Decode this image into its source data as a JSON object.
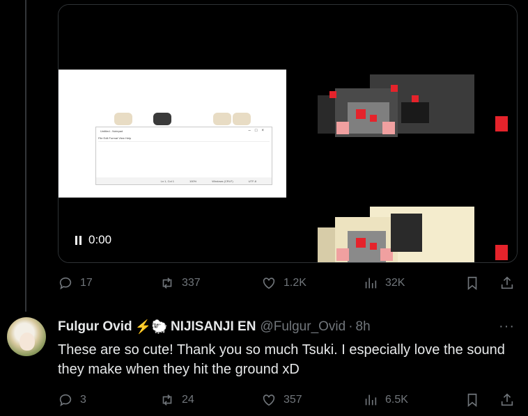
{
  "video": {
    "time": "0:00",
    "notepad": {
      "title": "Untitled - Notepad",
      "menu": "File  Edit  Format  View  Help",
      "status_pos": "Ln 1, Col 1",
      "status_zoom": "100%",
      "status_eol": "Windows (CRLF)",
      "status_enc": "UTF-8"
    }
  },
  "tweet1": {
    "stats": {
      "replies": "17",
      "reposts": "337",
      "likes": "1.2K",
      "views": "32K"
    }
  },
  "reply": {
    "name": "Fulgur Ovid",
    "name_emoji": "⚡🐑",
    "org": "NIJISANJI EN",
    "handle": "@Fulgur_Ovid",
    "sep": "·",
    "time": "8h",
    "more": "···",
    "text": "These are so cute! Thank you so much Tsuki. I especially love the sound they make when they hit the ground xD",
    "stats": {
      "replies": "3",
      "reposts": "24",
      "likes": "357",
      "views": "6.5K"
    }
  },
  "colors": {
    "background": "#000000",
    "text": "#e7e9ea",
    "muted": "#71767b",
    "border": "#2f3336",
    "pixel_red": "#e5232b"
  }
}
